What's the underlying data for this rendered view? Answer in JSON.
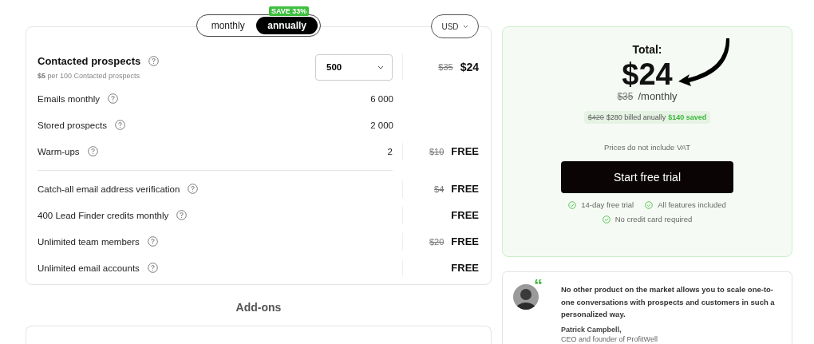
{
  "billing_toggle": {
    "options": [
      {
        "label": "monthly",
        "selected": false
      },
      {
        "label": "annually",
        "selected": true
      }
    ],
    "badge": "SAVE 33%"
  },
  "currency_select": {
    "value": "USD"
  },
  "plan": {
    "main": {
      "label": "Contacted prospects",
      "note": "**$5** per 100 Contacted prospects",
      "quantity": "500",
      "old_price": "$35",
      "price": "$24"
    },
    "usage_rows": [
      {
        "label": "Emails monthly",
        "value": "6 000"
      },
      {
        "label": "Stored prospects",
        "value": "2 000"
      },
      {
        "label": "Warm-ups",
        "value": "2",
        "old_price": "$10",
        "price": "FREE"
      }
    ],
    "included_rows": [
      {
        "label": "Catch-all email address verification",
        "old_price": "$4",
        "price": "FREE"
      },
      {
        "label": "400 Lead Finder credits monthly",
        "price": "FREE"
      },
      {
        "label": "Unlimited team members",
        "old_price": "$20",
        "price": "FREE"
      },
      {
        "label": "Unlimited email accounts",
        "price": "FREE"
      }
    ]
  },
  "addons": {
    "title": "Add-ons"
  },
  "summary": {
    "title": "Total:",
    "price": "$24",
    "old_price": "$35",
    "period": "/monthly",
    "billing": {
      "old": "$420",
      "text": "$280 billed anually",
      "saved": "$140 saved"
    },
    "vat_note": "Prices do not include VAT",
    "cta": "Start free trial",
    "features": [
      "14-day free trial",
      "All features included",
      "No credit card required"
    ]
  },
  "testimonial": {
    "mark": "“",
    "quote": "No other product on the market allows you to scale one-to-one conversations with prospects and customers in such a personalized way.",
    "author": "Patrick Campbell,",
    "role": "CEO and founder of ProfitWell"
  }
}
